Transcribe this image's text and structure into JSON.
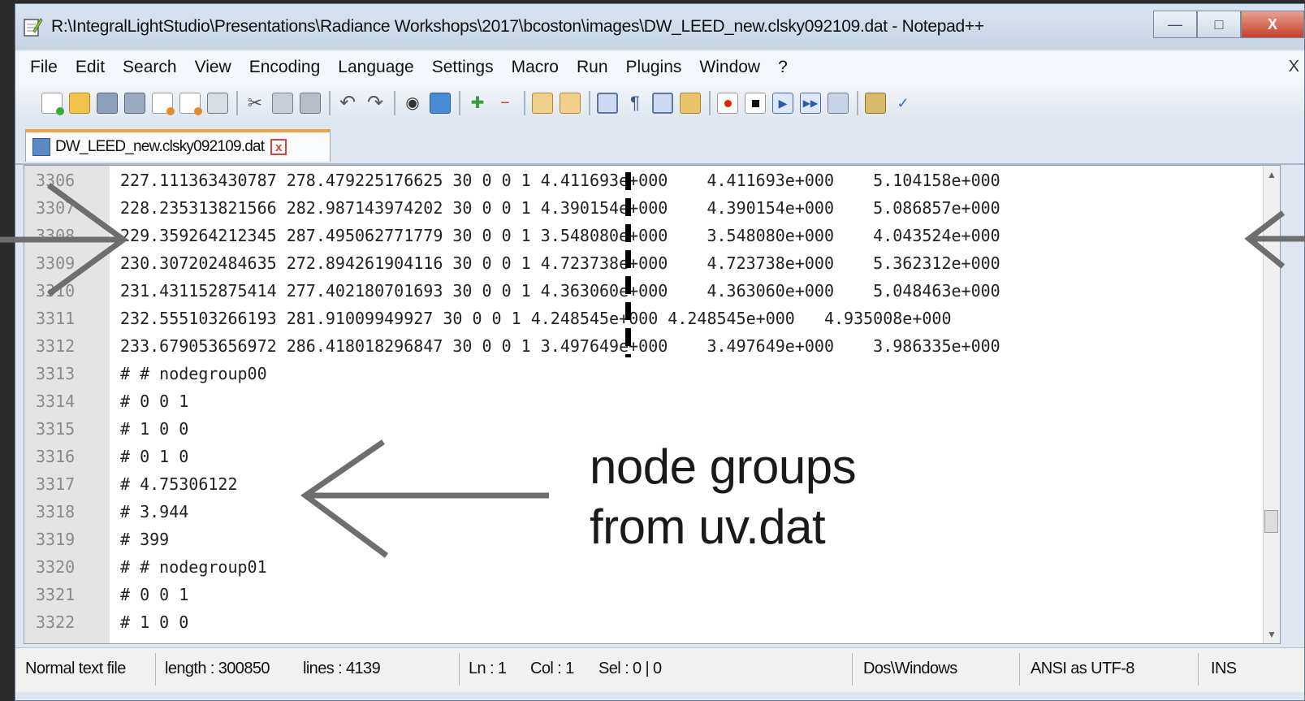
{
  "window": {
    "title": "R:\\IntegralLightStudio\\Presentations\\Radiance Workshops\\2017\\bcoston\\images\\DW_LEED_new.clsky092109.dat - Notepad++",
    "controls": {
      "minimize": "—",
      "maximize": "□",
      "close": "X"
    }
  },
  "menu": [
    "File",
    "Edit",
    "Search",
    "View",
    "Encoding",
    "Language",
    "Settings",
    "Macro",
    "Run",
    "Plugins",
    "Window",
    "?"
  ],
  "menu_close": "X",
  "tab": {
    "label": "DW_LEED_new.clsky092109.dat",
    "close": "x"
  },
  "editor": {
    "lines": [
      {
        "num": "3306",
        "text": "227.111363430787 278.479225176625 30 0 0 1 4.411693e+000    4.411693e+000    5.104158e+000"
      },
      {
        "num": "3307",
        "text": "228.235313821566 282.987143974202 30 0 0 1 4.390154e+000    4.390154e+000    5.086857e+000"
      },
      {
        "num": "3308",
        "text": "229.359264212345 287.495062771779 30 0 0 1 3.548080e+000    3.548080e+000    4.043524e+000"
      },
      {
        "num": "3309",
        "text": "230.307202484635 272.894261904116 30 0 0 1 4.723738e+000    4.723738e+000    5.362312e+000"
      },
      {
        "num": "3310",
        "text": "231.431152875414 277.402180701693 30 0 0 1 4.363060e+000    4.363060e+000    5.048463e+000"
      },
      {
        "num": "3311",
        "text": "232.555103266193 281.91009949927 30 0 0 1 4.248545e+000 4.248545e+000   4.935008e+000"
      },
      {
        "num": "3312",
        "text": "233.679053656972 286.418018296847 30 0 0 1 3.497649e+000    3.497649e+000    3.986335e+000"
      },
      {
        "num": "3313",
        "text": "# # nodegroup00"
      },
      {
        "num": "3314",
        "text": "# 0 0 1"
      },
      {
        "num": "3315",
        "text": "# 1 0 0"
      },
      {
        "num": "3316",
        "text": "# 0 1 0"
      },
      {
        "num": "3317",
        "text": "# 4.75306122"
      },
      {
        "num": "3318",
        "text": "# 3.944"
      },
      {
        "num": "3319",
        "text": "# 399"
      },
      {
        "num": "3320",
        "text": "# # nodegroup01"
      },
      {
        "num": "3321",
        "text": "# 0 0 1"
      },
      {
        "num": "3322",
        "text": "# 1 0 0"
      }
    ]
  },
  "status": {
    "file_type": "Normal text file",
    "length": "length : 300850",
    "lines": "lines : 4139",
    "ln": "Ln : 1",
    "col": "Col : 1",
    "sel": "Sel : 0 | 0",
    "eol": "Dos\\Windows",
    "encoding": "ANSI as UTF-8",
    "mode": "INS"
  },
  "annotation": {
    "line1": "node groups",
    "line2": "from uv.dat"
  },
  "toolbar_icons": [
    "new-file-icon",
    "open-file-icon",
    "save-icon",
    "save-all-icon",
    "close-icon",
    "close-all-icon",
    "print-icon",
    "cut-icon",
    "copy-icon",
    "paste-icon",
    "undo-icon",
    "redo-icon",
    "find-icon",
    "replace-icon",
    "zoom-in-icon",
    "zoom-out-icon",
    "sync-vertical-icon",
    "sync-horizontal-icon",
    "word-wrap-icon",
    "show-all-chars-icon",
    "indent-guide-icon",
    "doc-map-icon",
    "record-macro-icon",
    "stop-macro-icon",
    "play-macro-icon",
    "run-macro-multiple-icon",
    "save-macro-icon",
    "plugin-icon",
    "spell-check-icon"
  ]
}
